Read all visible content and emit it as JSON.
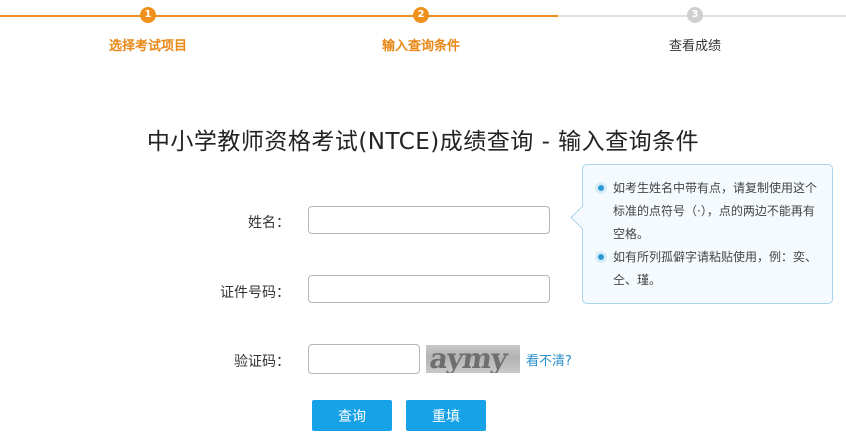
{
  "steps": [
    {
      "number": "1",
      "label": "选择考试项目",
      "state": "done"
    },
    {
      "number": "2",
      "label": "输入查询条件",
      "state": "active"
    },
    {
      "number": "3",
      "label": "查看成绩",
      "state": "pending"
    }
  ],
  "colors": {
    "accent": "#f0901c",
    "button": "#17a1e6",
    "inactive": "#cfcfcf",
    "link": "#2a8fc9"
  },
  "title": "中小学教师资格考试(NTCE)成绩查询 - 输入查询条件",
  "form": {
    "name_label": "姓名：",
    "id_label": "证件号码：",
    "captcha_label": "验证码：",
    "name_value": "",
    "id_value": "",
    "captcha_value": "",
    "captcha_image_text": "aymy",
    "captcha_refresh": "看不清?"
  },
  "buttons": {
    "query": "查询",
    "reset": "重填"
  },
  "tips": [
    "如考生姓名中带有点，请复制使用这个标准的点符号（·），点的两边不能再有空格。",
    "如有所列孤僻字请粘贴使用，例：奕、仝、瑾。"
  ]
}
